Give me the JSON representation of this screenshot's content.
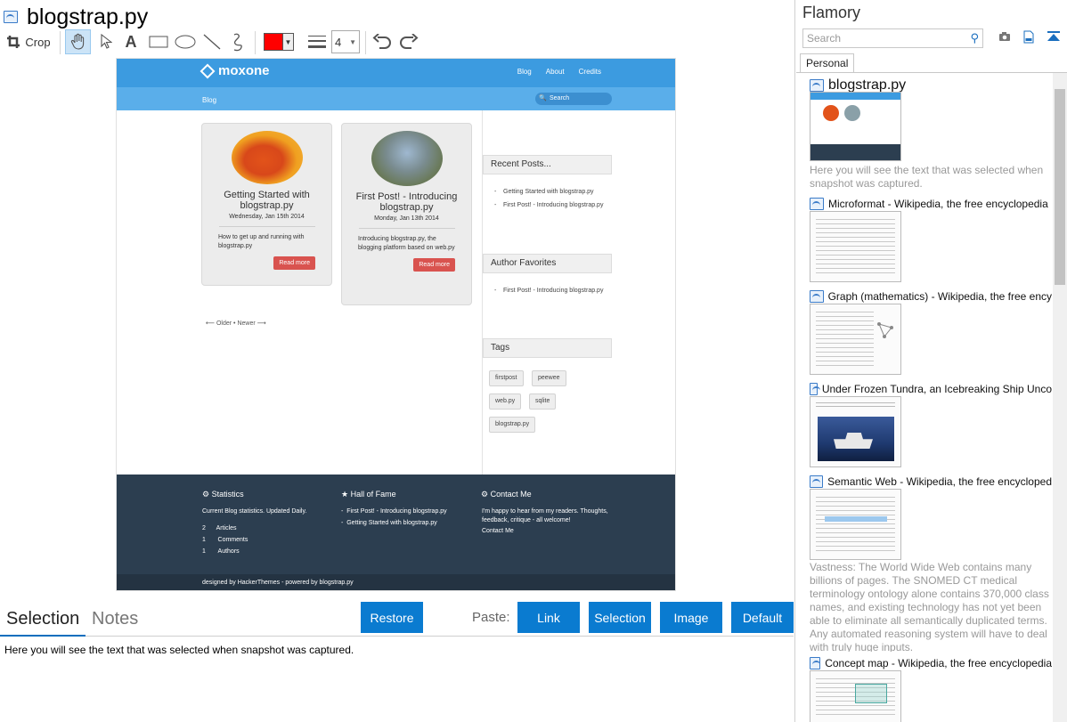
{
  "document": {
    "title": "blogstrap.py"
  },
  "toolbar": {
    "crop_label": "Crop",
    "text_tool": "A",
    "line_width": "4",
    "color": "#ff0000"
  },
  "site": {
    "brand": "moxone",
    "nav": [
      "Blog",
      "About",
      "Credits"
    ],
    "breadcrumb": "Blog",
    "search_placeholder": "Search",
    "posts": [
      {
        "title": "Getting Started with blogstrap.py",
        "date": "Wednesday, Jan 15th 2014",
        "excerpt": "How to get up and running with blogstrap.py",
        "button": "Read more"
      },
      {
        "title": "First Post! - Introducing blogstrap.py",
        "date": "Monday, Jan 13th 2014",
        "excerpt": "Introducing blogstrap.py, the blogging platform based on web.py",
        "button": "Read more"
      }
    ],
    "pager": "⟵ Older  •  Newer ⟶",
    "recent_posts": {
      "title": "Recent Posts...",
      "items": [
        "Getting Started with blogstrap.py",
        "First Post! - Introducing blogstrap.py"
      ]
    },
    "author_favorites": {
      "title": "Author Favorites",
      "items": [
        "First Post! - Introducing blogstrap.py"
      ]
    },
    "tags": {
      "title": "Tags",
      "items": [
        "firstpost",
        "peewee",
        "web.py",
        "sqlite",
        "blogstrap.py"
      ]
    },
    "footer": {
      "statistics_title": "Statistics",
      "statistics_text": "Current Blog statistics. Updated Daily.",
      "stats": [
        {
          "n": "2",
          "label": "Articles"
        },
        {
          "n": "1",
          "label": "Comments"
        },
        {
          "n": "1",
          "label": "Authors"
        }
      ],
      "hall_title": "Hall of Fame",
      "hall_items": [
        "First Post! - Introducing blogstrap.py",
        "Getting Started with blogstrap.py"
      ],
      "contact_title": "Contact Me",
      "contact_text": "I'm happy to hear from my readers. Thoughts, feedback, critique - all welcome!",
      "contact_link": "Contact Me",
      "credits": "designed by HackerThemes - powered by blogstrap.py"
    }
  },
  "bottom": {
    "tab_selection": "Selection",
    "tab_notes": "Notes",
    "restore": "Restore",
    "paste_label": "Paste:",
    "paste_buttons": [
      "Link",
      "Selection",
      "Image",
      "Default"
    ],
    "selection_text": "Here you will see the text that was selected when snapshot was captured."
  },
  "flamory": {
    "title": "Flamory",
    "search_placeholder": "Search",
    "tab": "Personal",
    "items": [
      {
        "title": "blogstrap.py",
        "desc": "Here you will see the text that was selected when snapshot was captured."
      },
      {
        "title": "Microformat - Wikipedia, the free encyclopedia"
      },
      {
        "title": "Graph (mathematics) - Wikipedia, the free ency"
      },
      {
        "title": "Under Frozen Tundra, an Icebreaking Ship Unco"
      },
      {
        "title": "Semantic Web - Wikipedia, the free encycloped",
        "desc": "Vastness: The World Wide Web contains many billions of pages. The SNOMED CT medical terminology ontology alone contains 370,000 class names, and existing technology has not yet been able to eliminate all semantically duplicated terms. Any automated reasoning system will have to deal with truly huge inputs."
      },
      {
        "title": "Concept map - Wikipedia, the free encyclopedia"
      }
    ]
  }
}
